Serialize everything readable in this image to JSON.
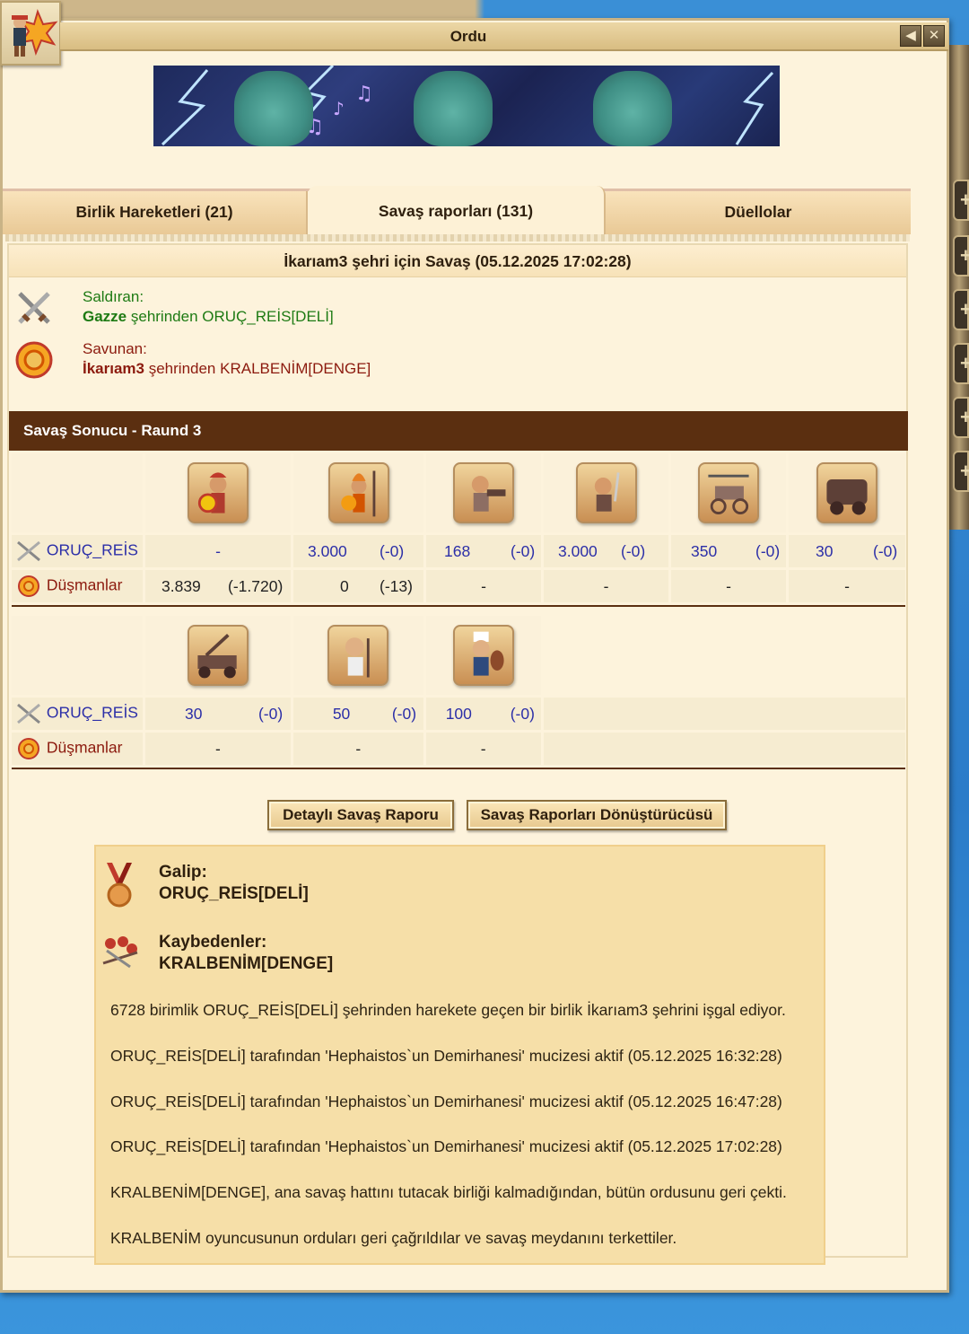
{
  "window": {
    "title": "Ordu"
  },
  "tabs": [
    {
      "label": "Birlik Hareketleri (21)"
    },
    {
      "label": "Savaş raporları (131)"
    },
    {
      "label": "Düellolar"
    }
  ],
  "report": {
    "heading": "İkarıam3 şehri için Savaş (05.12.2025 17:02:28)",
    "attacker_label": "Saldıran:",
    "attacker_city": "Gazze",
    "attacker_rest": " şehrinden ORUÇ_REİS[DELİ]",
    "defender_label": "Savunan:",
    "defender_city": "İkarıam3",
    "defender_rest": " şehrinden KRALBENİM[DENGE]",
    "result_title": "Savaş Sonucu - Raund 3",
    "row_labels": {
      "attacker": "ORUÇ_REİS",
      "defender": "Düşmanlar"
    },
    "block1": {
      "attacker": [
        [
          "-",
          ""
        ],
        [
          "3.000",
          "(-0)"
        ],
        [
          "168",
          "(-0)"
        ],
        [
          "3.000",
          "(-0)"
        ],
        [
          "350",
          "(-0)"
        ],
        [
          "30",
          "(-0)"
        ]
      ],
      "defender": [
        [
          "3.839",
          "(-1.720)"
        ],
        [
          "0",
          "(-13)"
        ],
        [
          "-",
          ""
        ],
        [
          "-",
          ""
        ],
        [
          "-",
          ""
        ],
        [
          "-",
          ""
        ]
      ]
    },
    "block2": {
      "attacker": [
        [
          "30",
          "(-0)"
        ],
        [
          "50",
          "(-0)"
        ],
        [
          "100",
          "(-0)"
        ]
      ],
      "defender": [
        [
          "-",
          ""
        ],
        [
          "-",
          ""
        ],
        [
          "-",
          ""
        ]
      ]
    },
    "buttons": {
      "detailed": "Detaylı Savaş Raporu",
      "converter": "Savaş Raporları Dönüştürücüsü"
    },
    "winner_label": "Galip:",
    "winner_name": "ORUÇ_REİS[DELİ]",
    "loser_label": "Kaybedenler:",
    "loser_name": "KRALBENİM[DENGE]",
    "messages": [
      "6728 birimlik ORUÇ_REİS[DELİ] şehrinden harekete geçen bir birlik İkarıam3 şehrini işgal ediyor.",
      "ORUÇ_REİS[DELİ] tarafından 'Hephaistos`un Demirhanesi' mucizesi aktif (05.12.2025 16:32:28)",
      "ORUÇ_REİS[DELİ] tarafından 'Hephaistos`un Demirhanesi' mucizesi aktif (05.12.2025 16:47:28)",
      "ORUÇ_REİS[DELİ] tarafından 'Hephaistos`un Demirhanesi' mucizesi aktif (05.12.2025 17:02:28)",
      "KRALBENİM[DENGE], ana savaş hattını tutacak birliği kalmadığından, bütün ordusunu geri çekti.",
      "KRALBENİM oyuncusunun orduları geri çağrıldılar ve savaş meydanını terkettiler."
    ]
  },
  "colors": {
    "accent_brown": "#5b2f10",
    "attacker_green": "#1d7a13",
    "defender_red": "#8c1a0e",
    "value_blue": "#2c2fa8"
  },
  "icons": [
    "army-logo-icon",
    "back-icon",
    "close-icon",
    "swords-icon",
    "shield-icon",
    "medal-icon",
    "fallen-icon",
    "hoplite-icon",
    "spartan-icon",
    "slinger-icon",
    "swordsman-icon",
    "gyrocopter-icon",
    "steam-giant-icon",
    "catapult-icon",
    "doctor-icon",
    "cook-icon"
  ]
}
